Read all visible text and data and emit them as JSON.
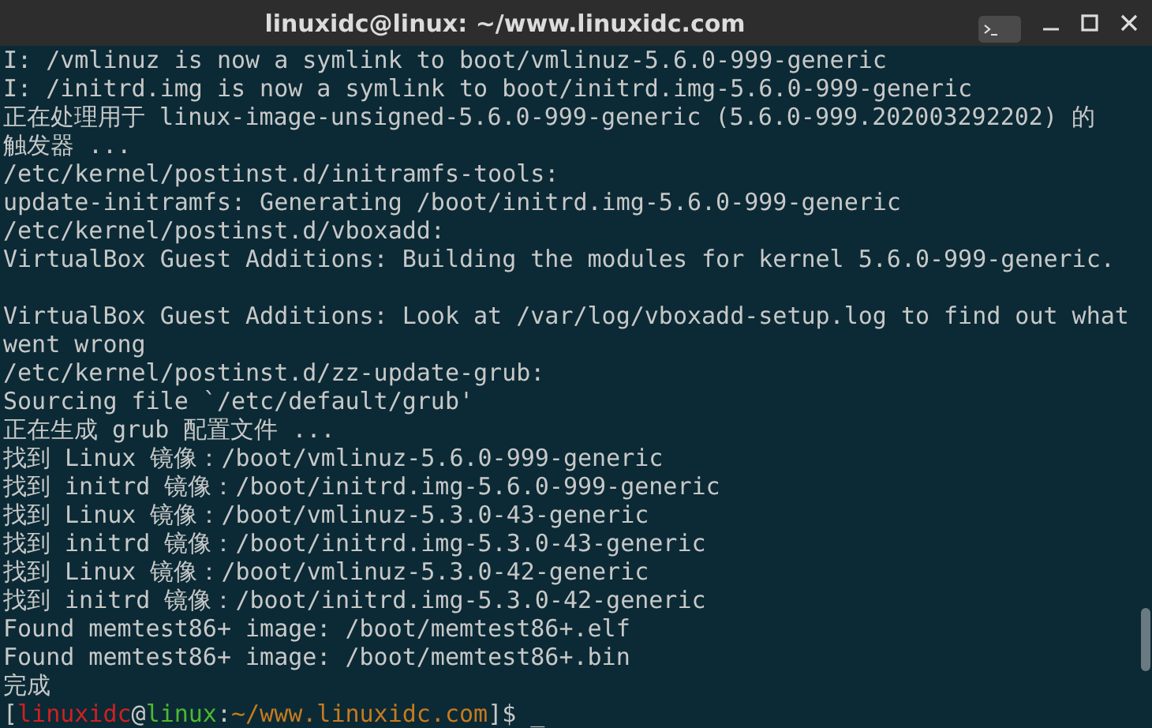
{
  "window": {
    "title": "linuxidc@linux: ~/www.linuxidc.com"
  },
  "lines": [
    {
      "kind": "text",
      "text": "I: /vmlinuz is now a symlink to boot/vmlinuz-5.6.0-999-generic"
    },
    {
      "kind": "text",
      "text": "I: /initrd.img is now a symlink to boot/initrd.img-5.6.0-999-generic"
    },
    {
      "kind": "text",
      "text": "正在处理用于 linux-image-unsigned-5.6.0-999-generic (5.6.0-999.202003292202) 的"
    },
    {
      "kind": "text",
      "text": "触发器 ..."
    },
    {
      "kind": "text",
      "text": "/etc/kernel/postinst.d/initramfs-tools:"
    },
    {
      "kind": "text",
      "text": "update-initramfs: Generating /boot/initrd.img-5.6.0-999-generic"
    },
    {
      "kind": "text",
      "text": "/etc/kernel/postinst.d/vboxadd:"
    },
    {
      "kind": "text",
      "text": "VirtualBox Guest Additions: Building the modules for kernel 5.6.0-999-generic."
    },
    {
      "kind": "blank"
    },
    {
      "kind": "text",
      "text": "VirtualBox Guest Additions: Look at /var/log/vboxadd-setup.log to find out what"
    },
    {
      "kind": "text",
      "text": "went wrong"
    },
    {
      "kind": "text",
      "text": "/etc/kernel/postinst.d/zz-update-grub:"
    },
    {
      "kind": "text",
      "text": "Sourcing file `/etc/default/grub'"
    },
    {
      "kind": "text",
      "text": "正在生成 grub 配置文件 ..."
    },
    {
      "kind": "text",
      "text": "找到 Linux 镜像：/boot/vmlinuz-5.6.0-999-generic"
    },
    {
      "kind": "text",
      "text": "找到 initrd 镜像：/boot/initrd.img-5.6.0-999-generic"
    },
    {
      "kind": "text",
      "text": "找到 Linux 镜像：/boot/vmlinuz-5.3.0-43-generic"
    },
    {
      "kind": "text",
      "text": "找到 initrd 镜像：/boot/initrd.img-5.3.0-43-generic"
    },
    {
      "kind": "text",
      "text": "找到 Linux 镜像：/boot/vmlinuz-5.3.0-42-generic"
    },
    {
      "kind": "text",
      "text": "找到 initrd 镜像：/boot/initrd.img-5.3.0-42-generic"
    },
    {
      "kind": "text",
      "text": "Found memtest86+ image: /boot/memtest86+.elf"
    },
    {
      "kind": "text",
      "text": "Found memtest86+ image: /boot/memtest86+.bin"
    },
    {
      "kind": "text",
      "text": "完成"
    }
  ],
  "prompt": [
    {
      "text": "[",
      "color": "#c8c8c8"
    },
    {
      "text": "linuxidc",
      "color": "#d02020"
    },
    {
      "text": "@",
      "color": "#c8c8c8"
    },
    {
      "text": "linux",
      "color": "#4eb82e"
    },
    {
      "text": ":",
      "color": "#c8c8c8"
    },
    {
      "text": "~/www.linuxidc.com",
      "color": "#c87a1e"
    },
    {
      "text": "]$",
      "color": "#c8c8c8"
    }
  ],
  "cursor": "_"
}
